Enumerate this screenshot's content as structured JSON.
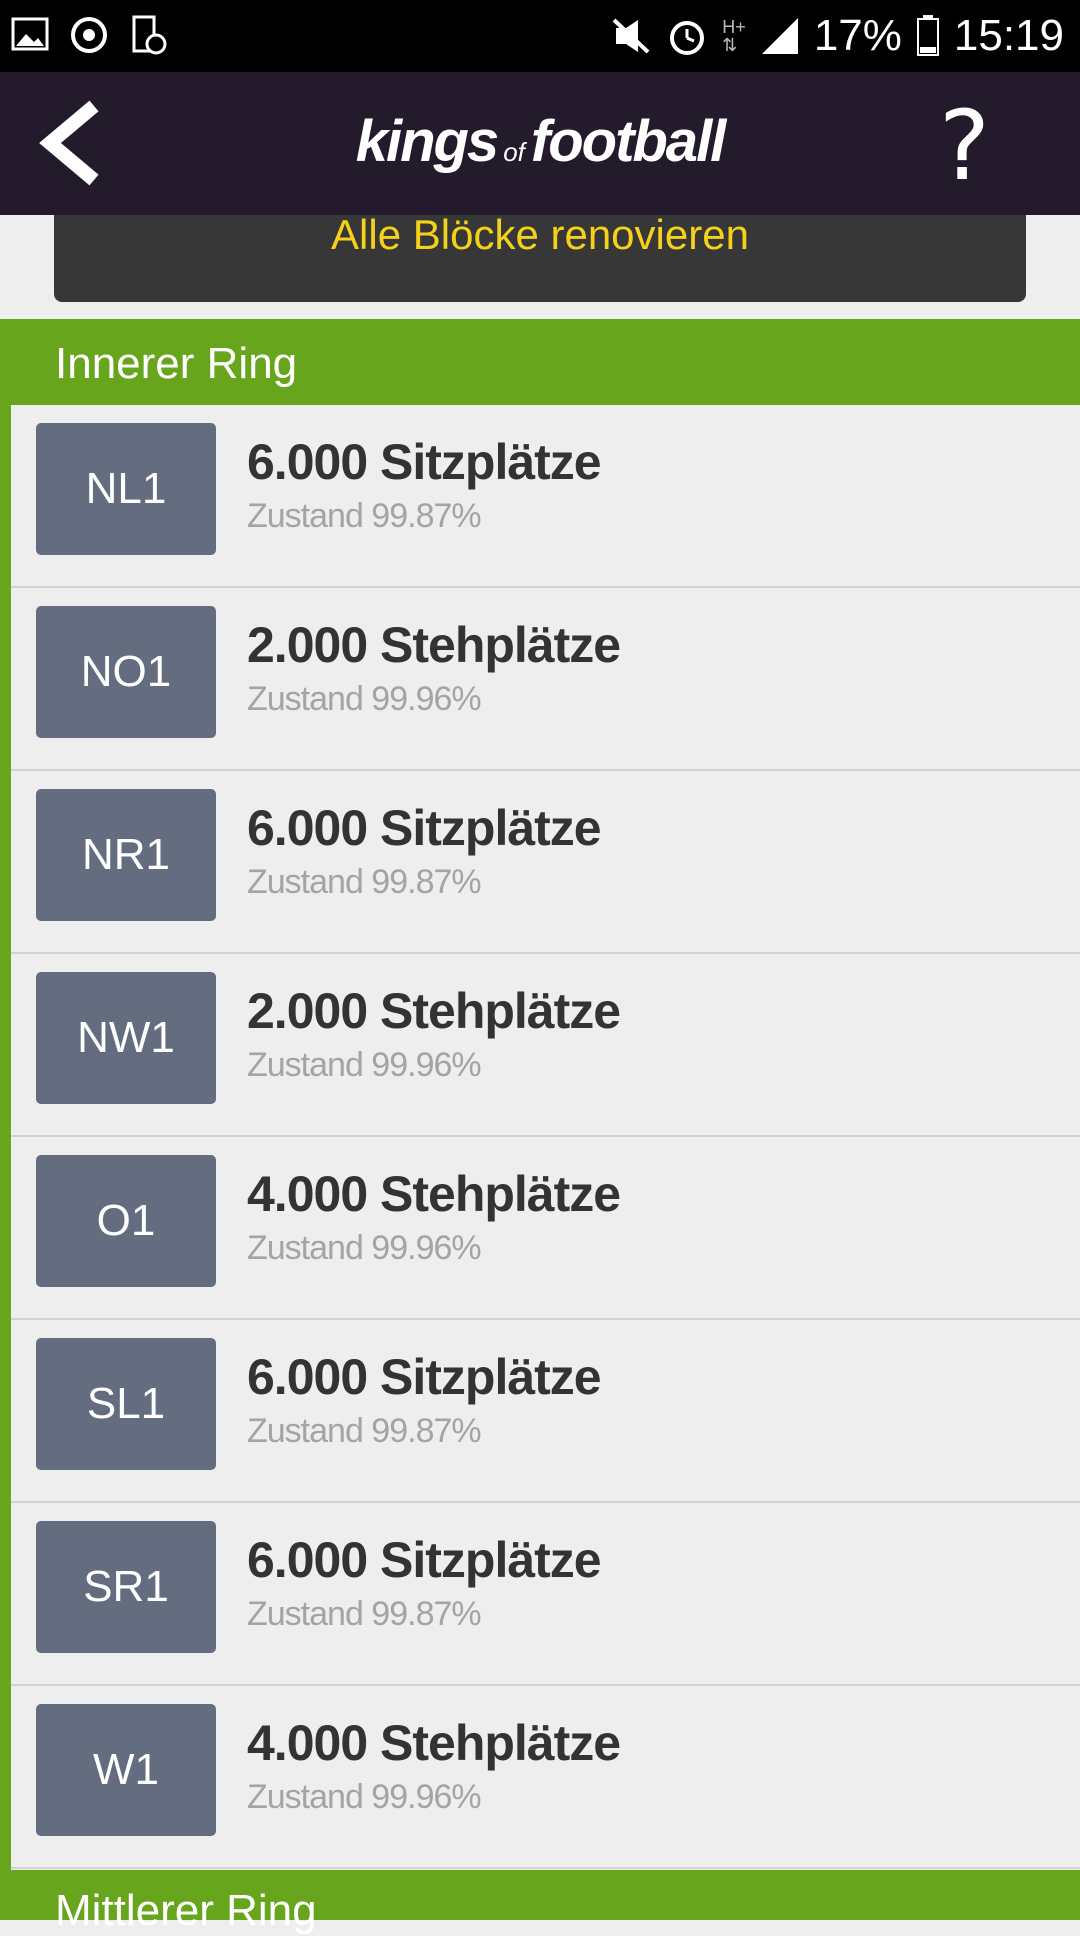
{
  "status_bar": {
    "battery": "17%",
    "time": "15:19",
    "network": "H+",
    "left_icons": [
      "image-icon",
      "sync-icon",
      "device-clock-icon"
    ],
    "right_icons": [
      "mute-icon",
      "alarm-icon",
      "signal-icon",
      "battery-icon"
    ]
  },
  "header": {
    "logo_part1": "kings",
    "logo_part2": "of",
    "logo_part3": "football",
    "help": "?"
  },
  "renovate_button": "Alle Blöcke renovieren",
  "sections": [
    {
      "title": "Innerer Ring",
      "blocks": [
        {
          "code": "NL1",
          "title": "6.000 Sitzplätze",
          "condition": "Zustand 99.87%"
        },
        {
          "code": "NO1",
          "title": "2.000 Stehplätze",
          "condition": "Zustand 99.96%"
        },
        {
          "code": "NR1",
          "title": "6.000 Sitzplätze",
          "condition": "Zustand 99.87%"
        },
        {
          "code": "NW1",
          "title": "2.000 Stehplätze",
          "condition": "Zustand 99.96%"
        },
        {
          "code": "O1",
          "title": "4.000 Stehplätze",
          "condition": "Zustand 99.96%"
        },
        {
          "code": "SL1",
          "title": "6.000 Sitzplätze",
          "condition": "Zustand 99.87%"
        },
        {
          "code": "SR1",
          "title": "6.000 Sitzplätze",
          "condition": "Zustand 99.87%"
        },
        {
          "code": "W1",
          "title": "4.000 Stehplätze",
          "condition": "Zustand 99.96%"
        }
      ]
    },
    {
      "title": "Mittlerer Ring",
      "blocks": []
    }
  ],
  "colors": {
    "accent_green": "#67a61c",
    "header_bg": "#231b2c",
    "button_text": "#f5d11a",
    "code_box": "#646c80"
  }
}
